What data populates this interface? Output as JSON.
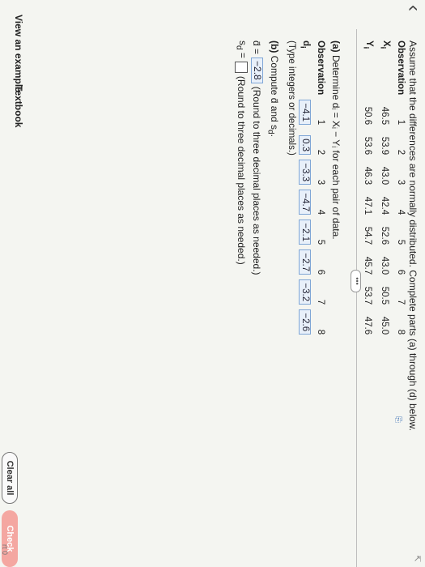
{
  "header": {
    "back_glyph": "‹",
    "intro": "Assume that the differences are normally distributed. Complete parts (a) through (d) below."
  },
  "observations": {
    "label_obs": "Observation",
    "label_x": "X",
    "label_x_sub": "i",
    "label_y": "Y",
    "label_y_sub": "i",
    "numbers": [
      "1",
      "2",
      "3",
      "4",
      "5",
      "6",
      "7",
      "8"
    ],
    "x": [
      "46.5",
      "53.9",
      "43.0",
      "42.4",
      "52.6",
      "43.0",
      "50.5",
      "45.0"
    ],
    "y": [
      "50.6",
      "53.6",
      "46.3",
      "47.1",
      "54.7",
      "45.7",
      "53.7",
      "47.6"
    ]
  },
  "more_label": "•••",
  "partA": {
    "prompt_bold": "(a)",
    "prompt": "Determine dᵢ = Xᵢ − Yᵢ for each pair of data.",
    "label_obs": "Observation",
    "label_d": "d",
    "label_d_sub": "i",
    "numbers": [
      "1",
      "2",
      "3",
      "4",
      "5",
      "6",
      "7",
      "8"
    ],
    "d": [
      "−4.1",
      "0.3",
      "−3.3",
      "−4.7",
      "−2.1",
      "−2.7",
      "−3.2",
      "−2.6"
    ],
    "hint": "(Type integers or decimals.)"
  },
  "partB": {
    "prompt_bold": "(b)",
    "prompt": "Compute d̄ and s",
    "prompt_sub": "d",
    "prompt_end": ".",
    "dbar_label": "d̄ =",
    "dbar_value": "−2.8",
    "dbar_hint": "(Round to three decimal places as needed.)",
    "sd_label": "s",
    "sd_sub": "d",
    "sd_eq": "=",
    "sd_hint": "(Round to three decimal places as needed.)"
  },
  "footer": {
    "view_example": "View an example",
    "textbook": "Textbook",
    "clear_all": "Clear all",
    "check_answer": "Check answer",
    "edge_text": "rt 0"
  },
  "colors": {
    "answer_box": "#e8f0fa",
    "check_button": "#f4a7a1"
  }
}
